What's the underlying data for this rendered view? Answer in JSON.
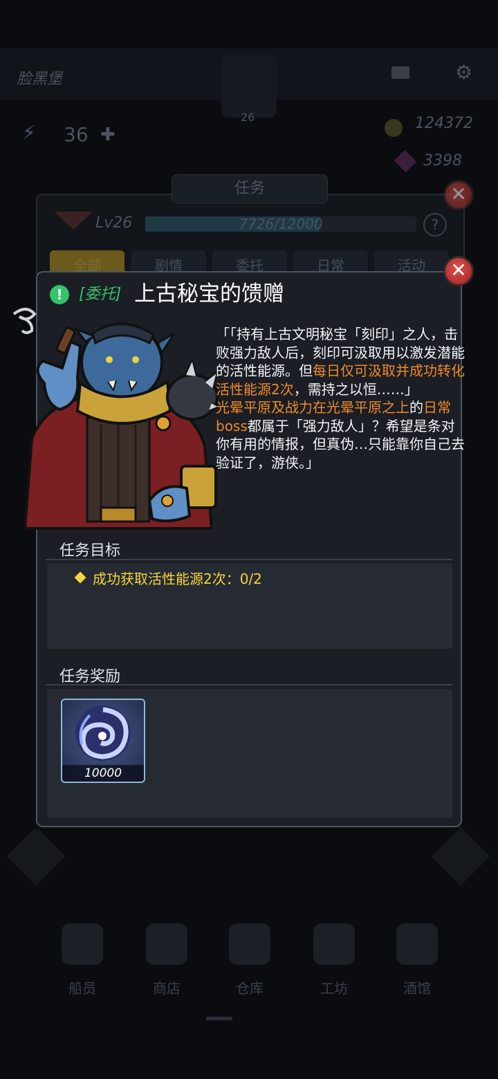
{
  "background": {
    "base_name": "脸黑堡",
    "player_level": "26",
    "stat_value": "36",
    "gold": "124372",
    "gems": "3398",
    "panel_title": "任务",
    "level_label": "Lv26",
    "xp_text": "7726/12000",
    "xp_progress": 0.644,
    "tabs": [
      "全部",
      "剧情",
      "委托",
      "日常",
      "活动"
    ],
    "nav": [
      "船员",
      "商店",
      "仓库",
      "工坊",
      "酒馆"
    ]
  },
  "dialog": {
    "tag": "[委托]",
    "title": "上古秘宝的馈赠",
    "description": [
      {
        "text": "「「持有上古文明秘宝「刻印」之人，击败强力敌人后，刻印可汲取用以激发潜能的活性能源。但",
        "color": "#f2f4f7"
      },
      {
        "text": "每日仅可汲取并成功转化活性能源2次",
        "color": "#f08a2a"
      },
      {
        "text": "，需持之以恒……」",
        "color": "#f2f4f7"
      },
      {
        "text": "光晕平原及战力在光晕平原之上",
        "color": "#f08a2a"
      },
      {
        "text": "的",
        "color": "#f2f4f7"
      },
      {
        "text": "日常boss",
        "color": "#f08a2a"
      },
      {
        "text": "都属于「强力敌人」？希望是条对你有用的情报，但真伪…只能靠你自己去验证了，游侠。」",
        "color": "#f2f4f7"
      }
    ],
    "objective_title": "任务目标",
    "objective_text": "成功获取活性能源2次：0/2",
    "reward_title": "任务奖励",
    "reward_amount": "10000"
  },
  "colors": {
    "accent_orange": "#f08a2a",
    "objective_yellow": "#f5d63a",
    "tag_green": "#34c26b",
    "close_red": "#d8423e"
  }
}
